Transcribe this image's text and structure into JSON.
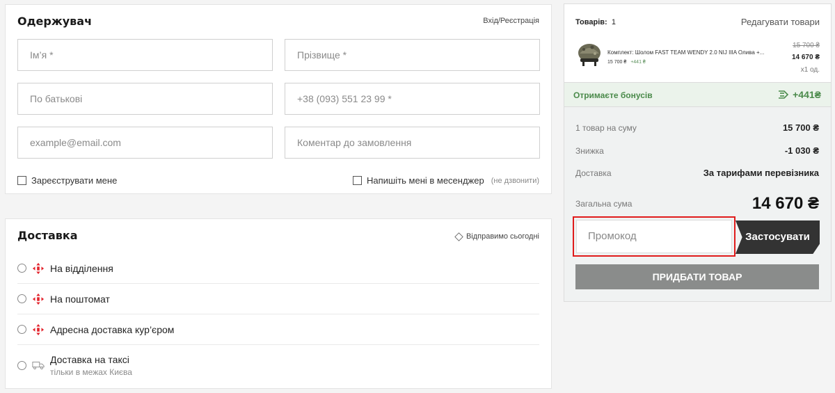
{
  "recipient": {
    "title": "Одержувач",
    "login_link": "Вхід/Реєстрація",
    "fields": {
      "first_name": "Ім’я *",
      "last_name": "Прізвище *",
      "patronymic": "По батькові",
      "phone": "+38 (093) 551 23 99 *",
      "email": "example@email.com",
      "comment": "Коментар до замовлення"
    },
    "register_label": "Зареєструвати мене",
    "messenger_label": "Напишіть мені в месенджер",
    "messenger_note": "(не дзвонити)"
  },
  "delivery": {
    "title": "Доставка",
    "ship_today": "Відправимо сьогодні",
    "options": [
      {
        "label": "На відділення",
        "icon": "nova-poshta-icon"
      },
      {
        "label": "На поштомат",
        "icon": "nova-poshta-icon"
      },
      {
        "label": "Адресна доставка кур’єром",
        "icon": "nova-poshta-icon"
      },
      {
        "label": "Доставка на таксі",
        "sublabel": "тільки в межах Києва",
        "icon": "truck-icon"
      }
    ]
  },
  "cart": {
    "items_label": "Товарів:",
    "items_count": "1",
    "edit_link": "Редагувати товари",
    "product": {
      "name": "Комплект: Шолом FAST TEAM WENDY 2.0 NIJ IIIA Олива +...",
      "price_small": "15 700 ₴",
      "bonus_small": "+441 ₴",
      "old_price": "15 700 ₴",
      "new_price": "14 670 ₴",
      "qty": "x1 од."
    },
    "bonus_label": "Отримаєте бонусів",
    "bonus_value": "+441₴",
    "summary": {
      "items_sum_label": "1 товар на суму",
      "items_sum_value": "15 700 ₴",
      "discount_label": "Знижка",
      "discount_value": "-1 030 ₴",
      "shipping_label": "Доставка",
      "shipping_value": "За тарифами перевізника",
      "total_label": "Загальна сума",
      "total_value": "14 670 ₴"
    },
    "promo_placeholder": "Промокод",
    "apply_label": "Застосувати",
    "buy_label": "ПРИДБАТИ ТОВАР"
  },
  "colors": {
    "accent_green": "#4a8a4a",
    "highlight_red": "#e01b1b",
    "button_dark": "#333333",
    "button_grey": "#8a8c8b",
    "nova_poshta_red": "#e3232c"
  }
}
